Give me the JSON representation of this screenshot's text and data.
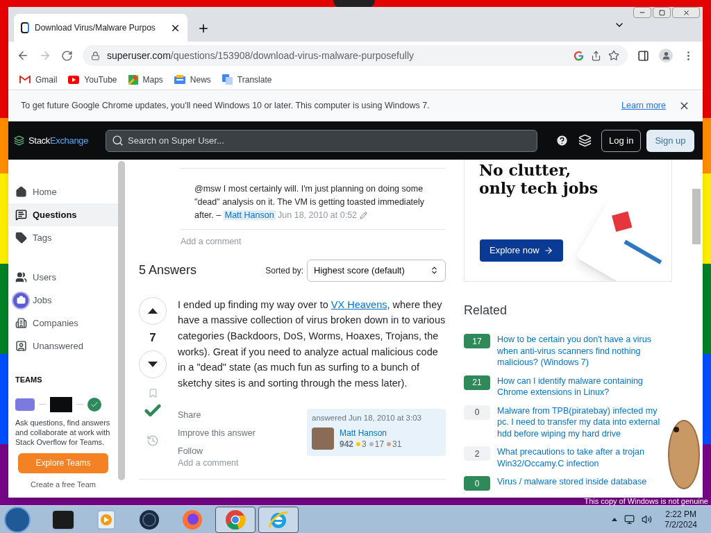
{
  "browser": {
    "tab_title": "Download Virus/Malware Purpos",
    "url_host": "superuser.com",
    "url_path": "/questions/153908/download-virus-malware-purposefully",
    "bookmarks": [
      {
        "label": "Gmail",
        "kind": "gmail"
      },
      {
        "label": "YouTube",
        "kind": "youtube"
      },
      {
        "label": "Maps",
        "kind": "maps"
      },
      {
        "label": "News",
        "kind": "news"
      },
      {
        "label": "Translate",
        "kind": "translate"
      }
    ],
    "infobar": {
      "text": "To get future Google Chrome updates, you'll need Windows 10 or later. This computer is using Windows 7.",
      "link": "Learn more"
    }
  },
  "site": {
    "logo_first": "Stack",
    "logo_second": "Exchange",
    "search_placeholder": "Search on Super User...",
    "login": "Log in",
    "signup": "Sign up"
  },
  "sidebar": {
    "groups": [
      {
        "items": [
          {
            "label": "Home",
            "selected": false
          },
          {
            "label": "Questions",
            "selected": true
          },
          {
            "label": "Tags",
            "selected": false
          }
        ]
      },
      {
        "items": [
          {
            "label": "Users",
            "selected": false
          },
          {
            "label": "Jobs",
            "selected": false
          },
          {
            "label": "Companies",
            "selected": false
          },
          {
            "label": "Unanswered",
            "selected": false
          }
        ]
      }
    ],
    "teams": {
      "heading": "TEAMS",
      "text": "Ask questions, find answers and collaborate at work with Stack Overflow for Teams.",
      "button": "Explore Teams",
      "create": "Create a free Team"
    }
  },
  "comment": {
    "text": "@msw I most certainly will. I'm just planning on doing some \"dead\" analysis on it. The VM is getting toasted immediately after. –",
    "author": "Matt Hanson",
    "date": "Jun 18, 2010 at 0:52"
  },
  "add_comment": "Add a comment",
  "answers_header": {
    "title": "5 Answers",
    "sort_label": "Sorted by:",
    "sort_value": "Highest score (default)"
  },
  "answer": {
    "votes": "7",
    "accepted": true,
    "text_before": "I ended up finding my way over to",
    "link": "VX Heavens",
    "text_after": ", where they have a massive collection of virus broken down in to various categories (Backdoors, DoS, Worms, Hoaxes, Trojans, the works). Great if you need to analyze actual malicious code in a \"dead\" state (as much fun as surfing to a bunch of sketchy sites is and sorting through the mess later).",
    "actions": [
      "Share",
      "Improve this answer",
      "Follow"
    ],
    "answered": "answered Jun 18, 2010 at 3:03",
    "user": "Matt Hanson",
    "reputation": "942",
    "badges": [
      {
        "count": "3",
        "color": "#ffcc01"
      },
      {
        "count": "17",
        "color": "#b4b8bc"
      },
      {
        "count": "31",
        "color": "#d1a684"
      }
    ],
    "add_comment": "Add a comment"
  },
  "ad": {
    "headline_1": "No clutter,",
    "headline_2": "only tech jobs",
    "button": "Explore now"
  },
  "related": {
    "heading": "Related",
    "items": [
      {
        "score": "17",
        "answered": true,
        "title": "How to be certain you don't have a virus when anti-virus scanners find nothing malicious? (Windows 7)"
      },
      {
        "score": "21",
        "answered": true,
        "title": "How can I identify malware containing Chrome extensions in Linux?"
      },
      {
        "score": "0",
        "answered": false,
        "title": "Malware from TPB(piratebay) infected my pc. I need to transfer my data into external hdd before wiping my hard drive"
      },
      {
        "score": "2",
        "answered": false,
        "title": "What precautions to take after a trojan Win32/Occamy.C infection"
      },
      {
        "score": "0",
        "answered": true,
        "title": "Virus / malware stored inside database"
      }
    ]
  },
  "taskbar": {
    "time": "2:22 PM",
    "date": "7/2/2024",
    "notice": "This copy of Windows is not genuine",
    "apps": [
      {
        "kind": "box",
        "active": false
      },
      {
        "kind": "media",
        "active": false
      },
      {
        "kind": "globe",
        "active": false
      },
      {
        "kind": "firefox",
        "active": false
      },
      {
        "kind": "chrome",
        "active": true
      },
      {
        "kind": "ie",
        "active": true
      }
    ]
  }
}
